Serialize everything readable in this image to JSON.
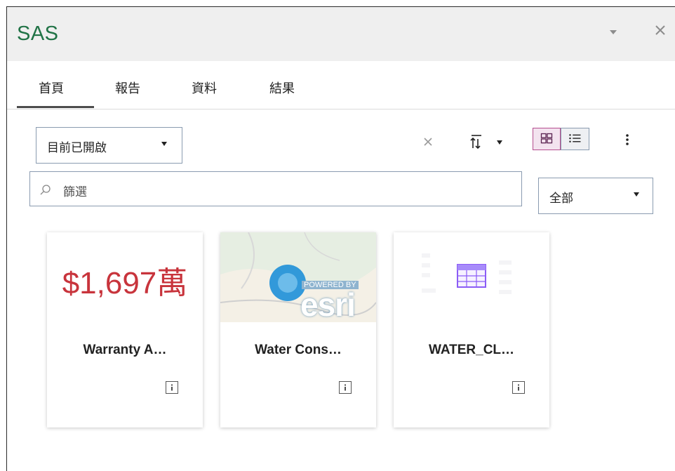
{
  "window": {
    "title": "SAS"
  },
  "tabs": [
    {
      "label": "首頁",
      "active": true
    },
    {
      "label": "報告",
      "active": false
    },
    {
      "label": "資料",
      "active": false
    },
    {
      "label": "結果",
      "active": false
    }
  ],
  "toolbar": {
    "filter_mode": "目前已開啟",
    "view_mode": "grid"
  },
  "search": {
    "placeholder": "篩選"
  },
  "type_filter": {
    "value": "全部"
  },
  "cards": [
    {
      "name": "Warranty A…",
      "thumbnail": "kpi",
      "kpi_value": "$1,697萬",
      "icon": "info-icon"
    },
    {
      "name": "Water Cons…",
      "thumbnail": "map",
      "logo_text": "esri",
      "logo_subtext": "POWERED BY",
      "icon": "info-icon"
    },
    {
      "name": "WATER_CL…",
      "thumbnail": "table",
      "icon": "info-icon"
    }
  ],
  "colors": {
    "brand": "#217346",
    "kpi": "#c8343c",
    "active_view": "#b54e8f"
  }
}
